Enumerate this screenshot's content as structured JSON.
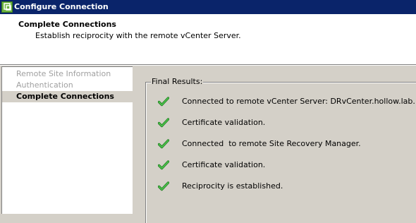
{
  "window": {
    "title": "Configure Connection",
    "icon": "vmware-app-icon"
  },
  "header": {
    "title": "Complete Connections",
    "subtitle": "Establish reciprocity with the remote vCenter Server."
  },
  "nav": {
    "items": [
      {
        "label": "Remote Site Information",
        "state": "done"
      },
      {
        "label": "Authentication",
        "state": "done"
      },
      {
        "label": "Complete Connections",
        "state": "active"
      }
    ]
  },
  "results": {
    "legend": "Final Results:",
    "items": [
      {
        "text": "Connected to remote vCenter Server: DRvCenter.hollow.lab.",
        "icon": "check-icon",
        "status_color": "#2e9a2e"
      },
      {
        "text": "Certificate validation.",
        "icon": "check-icon",
        "status_color": "#2e9a2e"
      },
      {
        "text": "Connected  to remote Site Recovery Manager.",
        "icon": "check-icon",
        "status_color": "#2e9a2e"
      },
      {
        "text": "Certificate validation.",
        "icon": "check-icon",
        "status_color": "#2e9a2e"
      },
      {
        "text": "Reciprocity is established.",
        "icon": "check-icon",
        "status_color": "#2e9a2e"
      }
    ]
  },
  "colors": {
    "titlebar": "#0a246a",
    "dialog_bg": "#d4d0c8",
    "header_bg": "#ffffff",
    "disabled_text": "#a0a0a0"
  }
}
